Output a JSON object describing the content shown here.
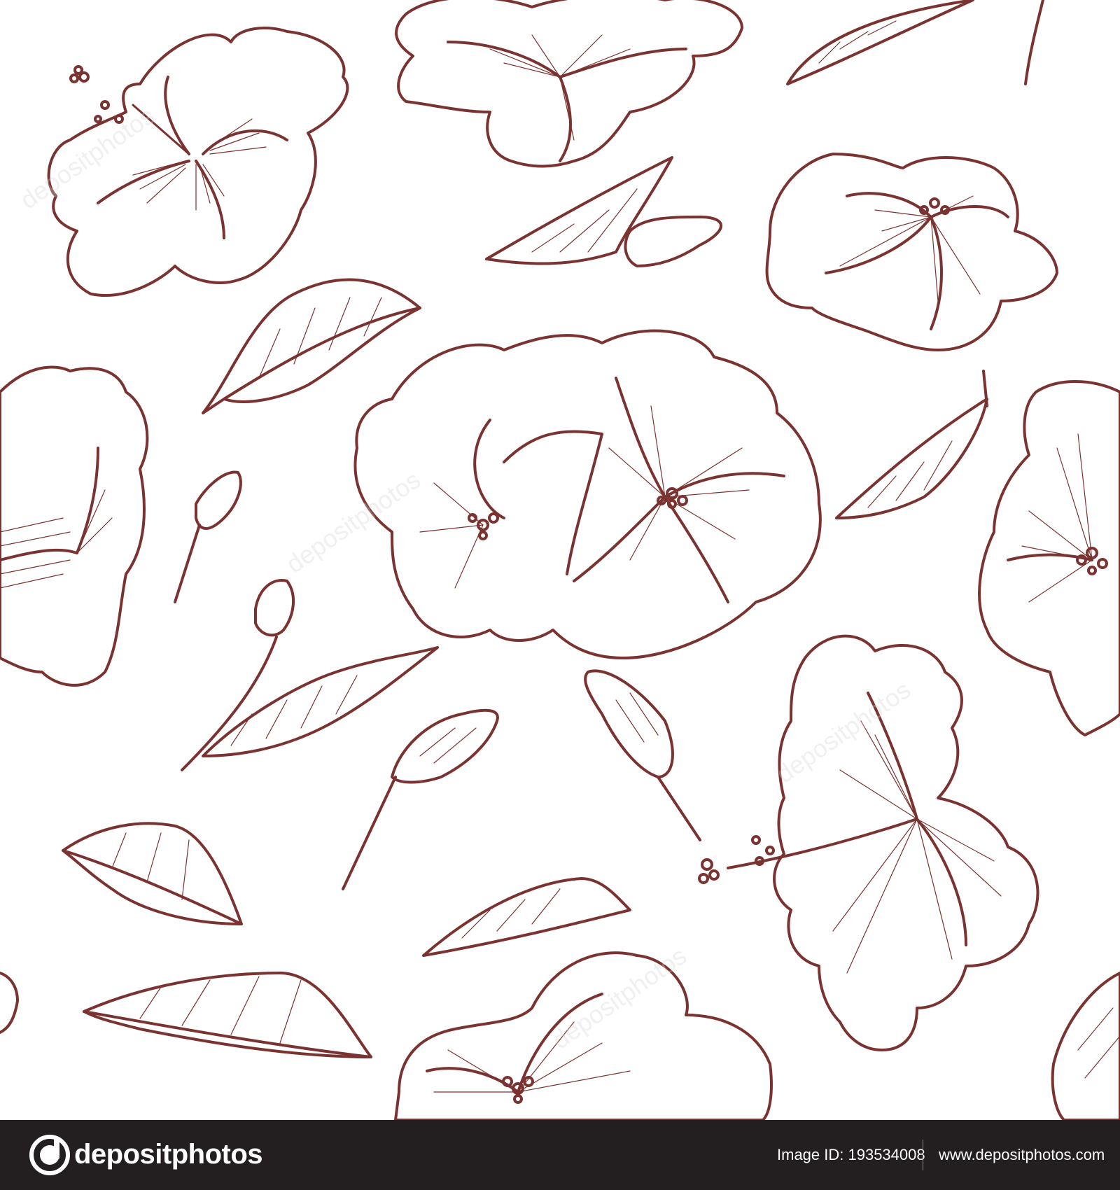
{
  "artwork": {
    "description_colors": {
      "line": "#7a3330",
      "background": "#ffffff",
      "footer": "#231f20"
    },
    "watermark_text": "depositphotos"
  },
  "footer": {
    "brand_name": "depositphotos",
    "image_id_label": "Image ID: 193534008",
    "site_url": "www.depositphotos.com",
    "logo_icon": "depositphotos-logo-icon"
  }
}
